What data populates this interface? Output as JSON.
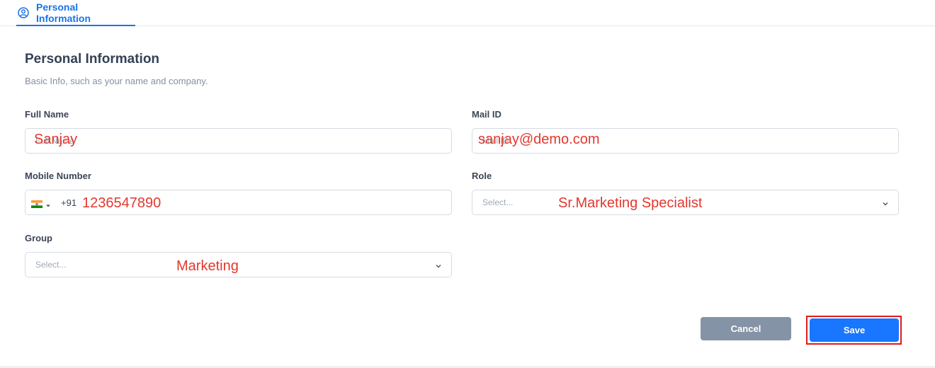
{
  "tab": {
    "label": "Personal Information"
  },
  "section": {
    "title": "Personal Information",
    "subtitle": "Basic Info, such as your name and company."
  },
  "fields": {
    "full_name": {
      "label": "Full Name",
      "placeholder": "Full Name",
      "value": "Sanjay"
    },
    "mail_id": {
      "label": "Mail ID",
      "placeholder": "Mail ID",
      "value": "sanjay@demo.com"
    },
    "mobile": {
      "label": "Mobile Number",
      "country_icon": "india-flag-icon",
      "dial_code": "+91",
      "value": "1236547890"
    },
    "role": {
      "label": "Role",
      "placeholder": "Select...",
      "value": "Sr.Marketing Specialist"
    },
    "group": {
      "label": "Group",
      "placeholder": "Select...",
      "value": "Marketing"
    }
  },
  "actions": {
    "cancel_label": "Cancel",
    "save_label": "Save"
  },
  "colors": {
    "accent": "#1a73e8",
    "save_button": "#1976ff",
    "cancel_button": "#8593a6",
    "annotation_red": "#e2382e"
  }
}
